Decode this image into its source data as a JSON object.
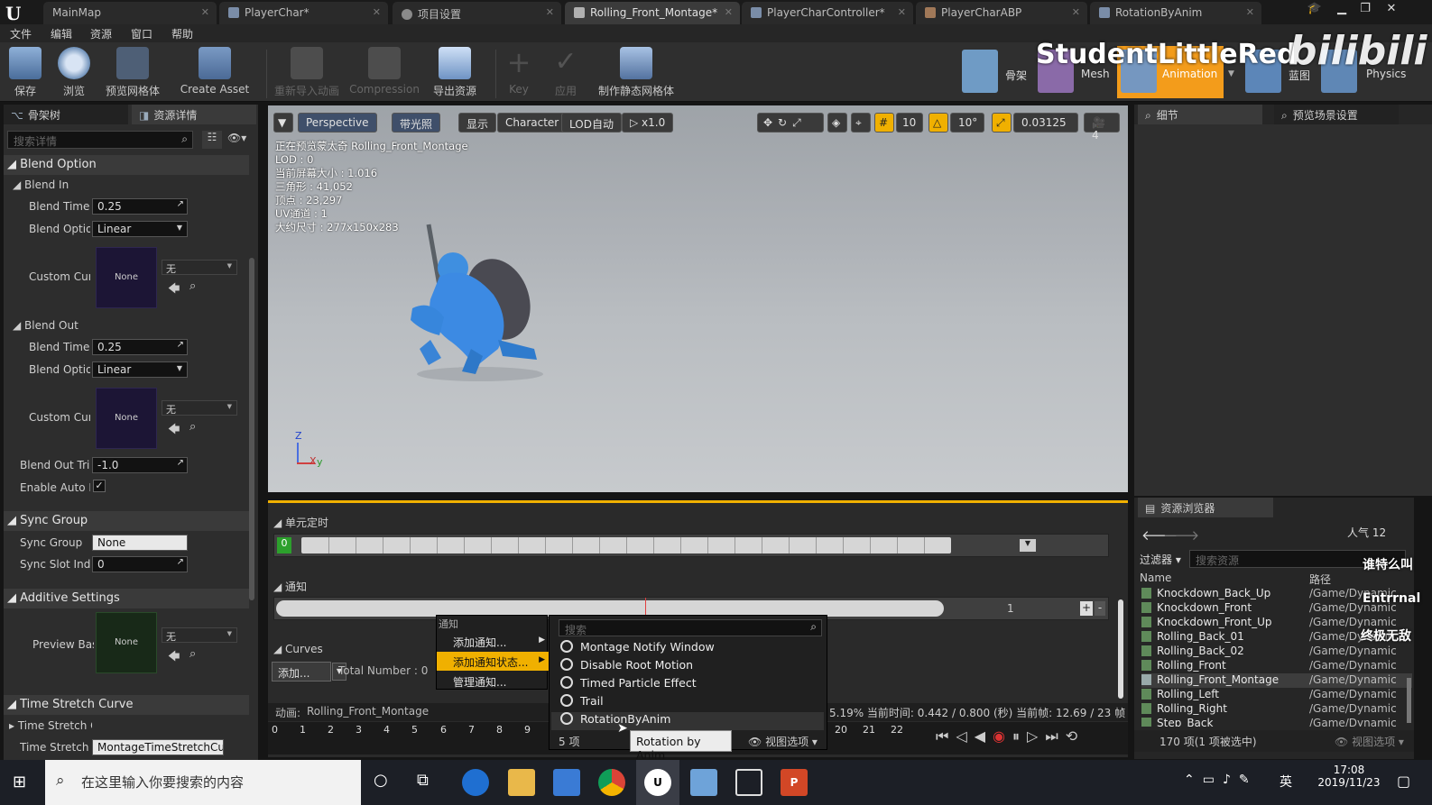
{
  "app": {
    "title_tabs": [
      {
        "label": "MainMap"
      },
      {
        "label": "PlayerChar*"
      },
      {
        "label": "项目设置"
      },
      {
        "label": "Rolling_Front_Montage*"
      },
      {
        "label": "PlayerCharController*"
      },
      {
        "label": "PlayerCharABP"
      },
      {
        "label": "RotationByAnim"
      }
    ],
    "menu": [
      "文件",
      "编辑",
      "资源",
      "窗口",
      "帮助"
    ]
  },
  "watermark": {
    "text": "StudentLittleRed",
    "side": "bilibili",
    "overlay1": "谁特么叫",
    "overlay2": "Entrrnal",
    "overlay3": "终极无敌"
  },
  "toolbar": {
    "buttons": [
      {
        "label": "保存"
      },
      {
        "label": "浏览"
      },
      {
        "label": "预览网格体"
      },
      {
        "label": "Create Asset"
      },
      {
        "label": "重新导入动画"
      },
      {
        "label": "Compression"
      },
      {
        "label": "导出资源"
      },
      {
        "label": "Key"
      },
      {
        "label": "应用"
      },
      {
        "label": "制作静态网格体"
      }
    ],
    "modes": [
      {
        "label": "骨架"
      },
      {
        "label": "Mesh"
      },
      {
        "label": "Animation"
      },
      {
        "label": "蓝图"
      },
      {
        "label": "Physics"
      }
    ]
  },
  "left_panel": {
    "tabs": [
      "骨架树",
      "资源详情"
    ],
    "search_placeholder": "搜索详情",
    "blend_option": {
      "header": "Blend Option",
      "blend_in": {
        "header": "Blend In",
        "blend_time_label": "Blend Time",
        "blend_time": "0.25",
        "blend_option_label": "Blend Option",
        "blend_option": "Linear",
        "custom_curve_label": "Custom Curve",
        "thumb": "None",
        "curve_combo": "无"
      },
      "blend_out": {
        "header": "Blend Out",
        "blend_time_label": "Blend Time",
        "blend_time": "0.25",
        "blend_option_label": "Blend Option",
        "blend_option": "Linear",
        "custom_curve_label": "Custom Curve",
        "thumb": "None",
        "curve_combo": "无"
      },
      "blend_out_trigger_label": "Blend Out Trigger",
      "blend_out_trigger": "-1.0",
      "enable_auto_label": "Enable Auto Blend Out"
    },
    "sync_group": {
      "header": "Sync Group",
      "sync_group_label": "Sync Group",
      "sync_group": "None",
      "sync_slot_label": "Sync Slot Index",
      "sync_slot": "0"
    },
    "additive": {
      "header": "Additive Settings",
      "preview_base_label": "Preview Base",
      "thumb": "None",
      "combo": "无"
    },
    "time_stretch": {
      "header": "Time Stretch Curve",
      "row1": "Time Stretch Curve",
      "row2_label": "Time Stretch Curve Name",
      "row2_value": "MontageTimeStretchCurve"
    }
  },
  "viewport": {
    "buttons": [
      "Perspective",
      "带光照",
      "显示",
      "Character",
      "LOD自动",
      "x1.0"
    ],
    "snap": {
      "grid": "10",
      "angle": "10°",
      "scale": "0.03125",
      "speed": "4"
    },
    "stats": [
      "正在预览蒙太奇 Rolling_Front_Montage",
      "LOD : 0",
      "当前屏幕大小 : 1.016",
      "三角形 : 41,052",
      "顶点 : 23,297",
      "UV通道 : 1",
      "大约尺寸 : 277x150x283"
    ],
    "axis": {
      "z": "Z",
      "x": "X",
      "y": "y"
    }
  },
  "timeline": {
    "section1": "单元定时",
    "section1_marker": "0",
    "section2": "通知",
    "notify_count": "1",
    "curves_header": "Curves",
    "add_button": "添加...",
    "total_number": "Total Number : 0",
    "anim_label": "动画:",
    "anim_name": "Rolling_Front_Montage",
    "status": "5.19% 当前时间: 0.442 / 0.800 (秒) 当前帧: 12.69 / 23 帧",
    "ruler": [
      "0",
      "1",
      "2",
      "3",
      "4",
      "5",
      "6",
      "7",
      "8",
      "9",
      "20",
      "21",
      "22"
    ]
  },
  "context_menu": {
    "header": "通知",
    "items": [
      "添加通知...",
      "添加通知状态...",
      "管理通知..."
    ]
  },
  "notify_submenu": {
    "search_placeholder": "搜索",
    "options": [
      "Montage Notify Window",
      "Disable Root Motion",
      "Timed Particle Effect",
      "Trail",
      "RotationByAnim"
    ],
    "count": "5 项",
    "view_options": "视图选项"
  },
  "tooltip": "Rotation by Anim",
  "right_panel": {
    "tabs": [
      "细节",
      "预览场景设置"
    ]
  },
  "content_browser": {
    "tab": "资源浏览器",
    "popularity": "人气 12",
    "filter": "过滤器",
    "search_placeholder": "搜索资源",
    "col_name": "Name",
    "col_path": "路径",
    "rows": [
      {
        "name": "Knockdown_Back_Up",
        "path": "/Game/Dynamic"
      },
      {
        "name": "Knockdown_Front",
        "path": "/Game/Dynamic"
      },
      {
        "name": "Knockdown_Front_Up",
        "path": "/Game/Dynamic"
      },
      {
        "name": "Rolling_Back_01",
        "path": "/Game/Dynamic"
      },
      {
        "name": "Rolling_Back_02",
        "path": "/Game/Dynamic"
      },
      {
        "name": "Rolling_Front",
        "path": "/Game/Dynamic"
      },
      {
        "name": "Rolling_Front_Montage",
        "path": "/Game/Dynamic"
      },
      {
        "name": "Rolling_Left",
        "path": "/Game/Dynamic"
      },
      {
        "name": "Rolling_Right",
        "path": "/Game/Dynamic"
      },
      {
        "name": "Step_Back",
        "path": "/Game/Dynamic"
      }
    ],
    "footer": "170 项(1 项被选中)",
    "view_options": "视图选项"
  },
  "taskbar": {
    "search": "在这里输入你要搜索的内容",
    "ime": "英",
    "time": "17:08",
    "date": "2019/11/23"
  },
  "colors": {
    "accent": "#f0b000",
    "selected_mode": "#f39c1b",
    "taskbar": "#1c1f26"
  }
}
